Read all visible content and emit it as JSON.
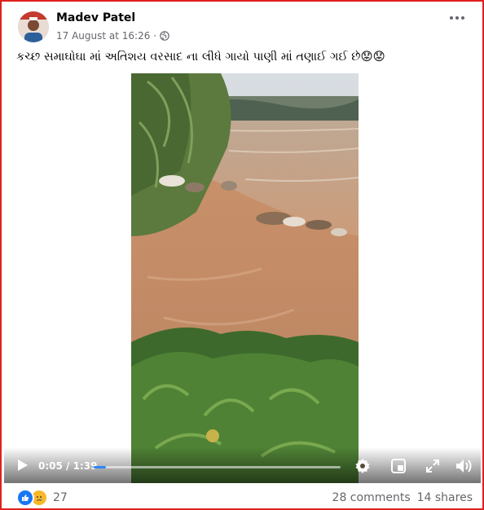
{
  "post": {
    "author_name": "Madev Patel",
    "timestamp": "17 August at 16:26",
    "separator": "·",
    "privacy_icon": "globe-icon",
    "caption": "કચ્છ સમાઘોઘા માં અતિશય વરસાદ ના લીધે ગાયો પાણી માં તણાઈ ગઈ છે😟😟"
  },
  "video": {
    "time_display": "0:05 / 1:39",
    "progress_fraction": 0.05,
    "controls": [
      "play-icon",
      "settings-icon",
      "picture-in-picture-icon",
      "fullscreen-icon",
      "volume-icon"
    ]
  },
  "footer": {
    "reaction_icons": [
      "like-icon",
      "sad-icon"
    ],
    "reaction_count": "27",
    "comments": "28 comments",
    "shares": "14 shares"
  },
  "colors": {
    "border": "#e0201b",
    "like_blue": "#1877f2",
    "sad_yellow": "#f7b928",
    "progress_blue": "#2d88ff"
  }
}
